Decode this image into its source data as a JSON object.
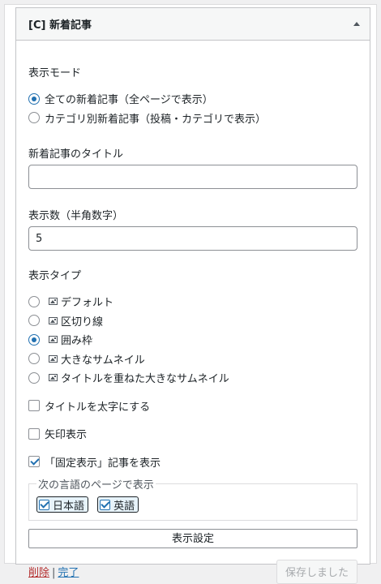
{
  "widget": {
    "title": "[C] 新着記事"
  },
  "display_mode": {
    "label": "表示モード",
    "options": [
      {
        "label": "全ての新着記事（全ページで表示）",
        "checked": true
      },
      {
        "label": "カテゴリ別新着記事（投稿・カテゴリで表示）",
        "checked": false
      }
    ]
  },
  "title_field": {
    "label": "新着記事のタイトル",
    "value": ""
  },
  "count_field": {
    "label": "表示数（半角数字）",
    "value": "5"
  },
  "display_type": {
    "label": "表示タイプ",
    "options": [
      {
        "label": "デフォルト",
        "checked": false
      },
      {
        "label": "区切り線",
        "checked": false
      },
      {
        "label": "囲み枠",
        "checked": true
      },
      {
        "label": "大きなサムネイル",
        "checked": false
      },
      {
        "label": "タイトルを重ねた大きなサムネイル",
        "checked": false
      }
    ]
  },
  "checkboxes": {
    "bold_title": {
      "label": "タイトルを太字にする",
      "checked": false
    },
    "arrow": {
      "label": "矢印表示",
      "checked": false
    },
    "sticky": {
      "label": "「固定表示」記事を表示",
      "checked": true
    }
  },
  "languages": {
    "legend": "次の言語のページで表示",
    "items": [
      {
        "label": "日本語",
        "checked": true
      },
      {
        "label": "英語",
        "checked": true
      }
    ]
  },
  "buttons": {
    "display_settings": "表示設定",
    "delete": "削除",
    "separator": "|",
    "done": "完了",
    "save": "保存しました"
  },
  "colors": {
    "accent": "#2271b1",
    "delete": "#b32d2e"
  }
}
